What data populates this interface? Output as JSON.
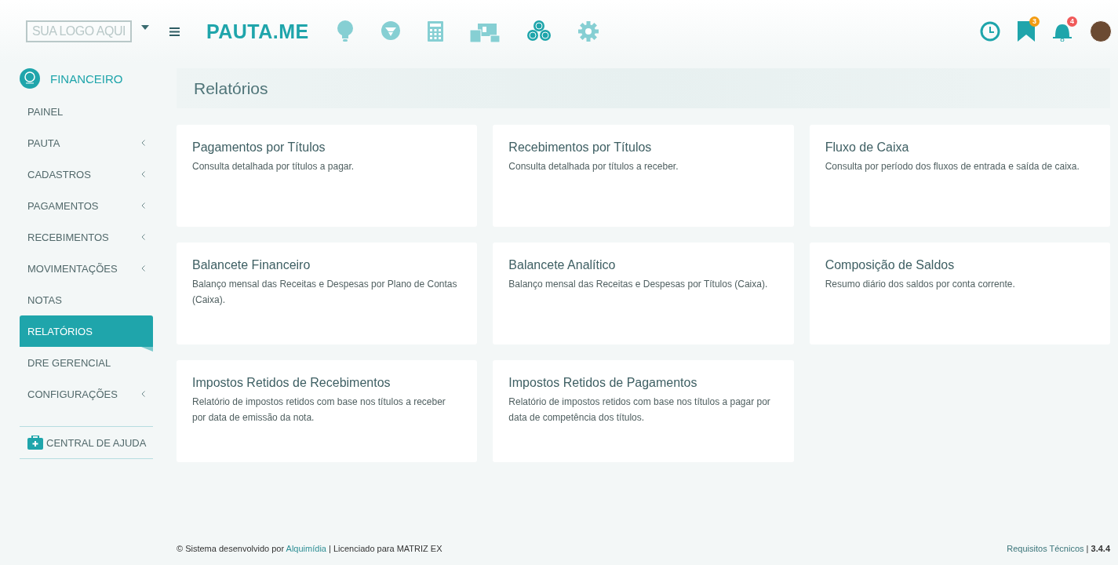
{
  "header": {
    "logo_text": "SUA LOGO AQUI",
    "brand": "PAUTA.ME",
    "badges": [
      {
        "kind": "bookmark",
        "count": "3",
        "color": "#f39c12"
      },
      {
        "kind": "bell",
        "count": "4",
        "color": "#f05a5a"
      }
    ]
  },
  "sidebar": {
    "module": "FINANCEIRO",
    "items": [
      {
        "label": "PAINEL",
        "submenu": false,
        "selected": false
      },
      {
        "label": "PAUTA",
        "submenu": true,
        "selected": false
      },
      {
        "label": "CADASTROS",
        "submenu": true,
        "selected": false
      },
      {
        "label": "PAGAMENTOS",
        "submenu": true,
        "selected": false
      },
      {
        "label": "RECEBIMENTOS",
        "submenu": true,
        "selected": false
      },
      {
        "label": "MOVIMENTAÇÕES",
        "submenu": true,
        "selected": false
      },
      {
        "label": "NOTAS",
        "submenu": false,
        "selected": false
      },
      {
        "label": "RELATÓRIOS",
        "submenu": false,
        "selected": true
      },
      {
        "label": "DRE GERENCIAL",
        "submenu": false,
        "selected": false
      },
      {
        "label": "CONFIGURAÇÕES",
        "submenu": true,
        "selected": false
      }
    ],
    "help": "CENTRAL DE AJUDA"
  },
  "page_title": "Relatórios",
  "cards": [
    {
      "title": "Pagamentos por Títulos",
      "description": "Consulta detalhada por títulos a pagar."
    },
    {
      "title": "Recebimentos por Títulos",
      "description": "Consulta detalhada por títulos a receber."
    },
    {
      "title": "Fluxo de Caixa",
      "description": "Consulta por período dos fluxos de entrada e saída de caixa."
    },
    {
      "title": "Balancete Financeiro",
      "description": "Balanço mensal das Receitas e Despesas por Plano de Contas (Caixa)."
    },
    {
      "title": "Balancete Analítico",
      "description": "Balanço mensal das Receitas e Despesas por Títulos (Caixa)."
    },
    {
      "title": "Composição de Saldos",
      "description": "Resumo diário dos saldos por conta corrente."
    },
    {
      "title": "Impostos Retidos de Recebimentos",
      "description": "Relatório de impostos retidos com base nos títulos a receber por data de emissão da nota."
    },
    {
      "title": "Impostos Retidos de Pagamentos",
      "description": "Relatório de impostos retidos com base nos títulos a pagar por data de competência dos títulos."
    }
  ],
  "footer": {
    "prefix": "© Sistema desenvolvido por ",
    "link": "Alquimídia",
    "suffix": " | Licenciado para MATRIZ EX",
    "requirements": "Requisitos Técnicos",
    "separator": "|",
    "version": "3.4.4"
  }
}
